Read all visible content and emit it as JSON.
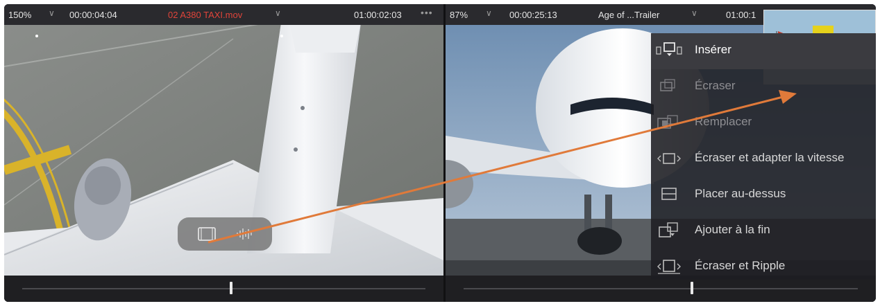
{
  "source_viewer": {
    "zoom": "150%",
    "timecode": "00:00:04:04",
    "clip_name": "02 A380 TAXI.mov",
    "end_timecode": "01:00:02:03",
    "more_label": "•••",
    "clip_name_color": "#e0443a"
  },
  "timeline_viewer": {
    "zoom": "87%",
    "timecode": "00:00:25:13",
    "clip_name": "Age of ...Trailer",
    "end_timecode": "01:00:1"
  },
  "chevron": "∨",
  "edit_menu": {
    "items": [
      {
        "label": "Insérer",
        "icon": "insert-icon",
        "state": "active"
      },
      {
        "label": "Écraser",
        "icon": "overwrite-icon",
        "state": "dim"
      },
      {
        "label": "Remplacer",
        "icon": "replace-icon",
        "state": "dim"
      },
      {
        "label": "Écraser et adapter la vitesse",
        "icon": "fit-to-fill-icon",
        "state": "normal"
      },
      {
        "label": "Placer au-dessus",
        "icon": "place-on-top-icon",
        "state": "normal"
      },
      {
        "label": "Ajouter à la fin",
        "icon": "append-at-end-icon",
        "state": "normal"
      },
      {
        "label": "Écraser et Ripple",
        "icon": "ripple-overwrite-icon",
        "state": "normal"
      }
    ]
  },
  "colors": {
    "accent_arrow": "#e07a3a",
    "panel_bg": "#1f1f22",
    "topbar_bg": "#2a2a2e"
  },
  "source_scrubber": {
    "position": 0.51
  },
  "timeline_scrubber": {
    "position": 0.57
  }
}
